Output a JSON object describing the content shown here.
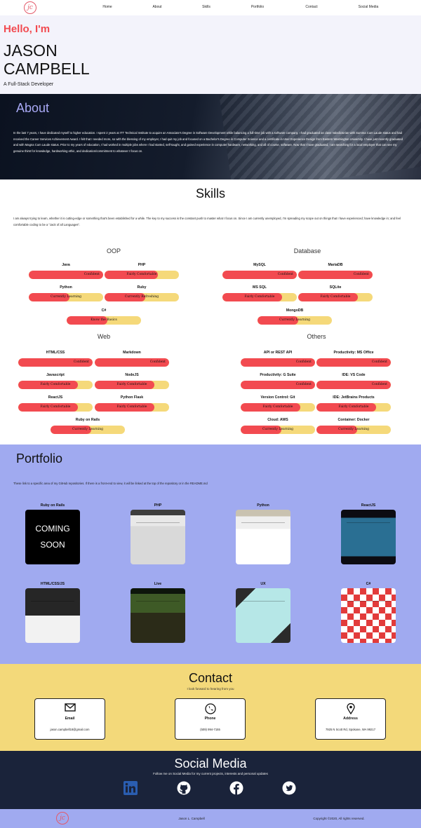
{
  "nav": {
    "logo_text": "jc",
    "items": [
      "Home",
      "About",
      "Skills",
      "Portfolio",
      "Contact",
      "Social Media"
    ]
  },
  "hero": {
    "greeting": "Hello, I'm",
    "name": "JASON CAMPBELL",
    "title": "A Full-Stack Developer"
  },
  "about": {
    "title": "About",
    "text": "In the last 7 years, I have dedicated myself to higher education. I spent 2 years at ITT Technical Institute to acquire an Associate's Degree in Software Development while balancing a full-time job with a software company. I had graduated as class Valedictorian with Summa Cum Laude status and had received the Career Services Achievement Award. I felt that I needed more, so with the blessing of my employer, I had quit my job and focused on a Bachelor's Degree in Computer Science and a certificate in User Experience Design from Eastern Washington University. I have just recently graduated and with Magna Cum Laude status. Prior to my years of education, I had worked in multiple jobs where I had started, self-taught, and gained experience in computer hardware, networking, and all of course, software. Now that I have graduated, I am searching for a local employer that can see my genuine thirst for knowledge, hardworking ethic, and dedication/commitment to whatever I focus on."
  },
  "skills": {
    "title": "Skills",
    "intro": "I am always trying to learn, whether it is cutting-edge or something that's been established for a while. The key to my success is the constant push to master what I focus on. Since I am currently unemployed, I'm spreading my scope out on things that I have experienced; have knowledge in; and feel comfortable coding to be a \"Jack of all Languages\".",
    "categories": [
      {
        "title": "OOP",
        "items": [
          {
            "name": "Java",
            "level": "Confident",
            "fill": 1.0
          },
          {
            "name": "PHP",
            "level": "Fairly Comfortable",
            "fill": 0.72
          },
          {
            "name": "Python",
            "level": "Currently Learning",
            "fill": 0.55
          },
          {
            "name": "Ruby",
            "level": "Currently Refreshing",
            "fill": 0.55
          },
          {
            "name": "C#",
            "level": "Know the Basics",
            "fill": 0.55
          }
        ]
      },
      {
        "title": "Database",
        "items": [
          {
            "name": "MySQL",
            "level": "Confident",
            "fill": 1.0
          },
          {
            "name": "MariaDB",
            "level": "Confident",
            "fill": 1.0
          },
          {
            "name": "MS SQL",
            "level": "Fairly Comfortable",
            "fill": 0.8
          },
          {
            "name": "SQLite",
            "level": "Fairly Comfortable",
            "fill": 0.8
          },
          {
            "name": "MongoDB",
            "level": "Currently Learning",
            "fill": 0.55
          }
        ]
      },
      {
        "title": "Web",
        "items": [
          {
            "name": "HTML/CSS",
            "level": "Confident",
            "fill": 1.0
          },
          {
            "name": "Markdown",
            "level": "Confident",
            "fill": 1.0
          },
          {
            "name": "Javascript",
            "level": "Fairly Comfortable",
            "fill": 0.8
          },
          {
            "name": "NodeJS",
            "level": "Fairly Comfortable",
            "fill": 0.8
          },
          {
            "name": "ReactJS",
            "level": "Fairly Comfortable",
            "fill": 0.8
          },
          {
            "name": "Python Flask",
            "level": "Fairly Comfortable",
            "fill": 0.8
          },
          {
            "name": "Ruby on Rails",
            "level": "Currently Learning",
            "fill": 0.55
          }
        ]
      },
      {
        "title": "Others",
        "items": [
          {
            "name": "API or REST API",
            "level": "Confident",
            "fill": 1.0
          },
          {
            "name": "Productivity: MS Office",
            "level": "Confident",
            "fill": 1.0
          },
          {
            "name": "Productivity: G Suite",
            "level": "Confident",
            "fill": 1.0
          },
          {
            "name": "IDE: VS Code",
            "level": "Confident",
            "fill": 1.0
          },
          {
            "name": "Version Control: Git",
            "level": "Fairly Comfortable",
            "fill": 0.8
          },
          {
            "name": "IDE: JetBrains Products",
            "level": "Fairly Comfortable",
            "fill": 0.8
          },
          {
            "name": "Cloud: AWS",
            "level": "Currently Learning",
            "fill": 0.55
          },
          {
            "name": "Container: Docker",
            "level": "Currently Learning",
            "fill": 0.55
          }
        ]
      }
    ]
  },
  "portfolio": {
    "title": "Portfolio",
    "intro": "These link to a specific area of my GitHub repositories. If there is a front-end to view, it will be linked at the top of the repository or in the README.md",
    "projects": [
      {
        "label": "Ruby on Rails",
        "thumb": "COMING SOON"
      },
      {
        "label": "PHP",
        "thumb": ""
      },
      {
        "label": "Python",
        "thumb": ""
      },
      {
        "label": "ReactJS",
        "thumb": ""
      },
      {
        "label": "HTML/CSS/JS",
        "thumb": ""
      },
      {
        "label": "Live",
        "thumb": ""
      },
      {
        "label": "UX",
        "thumb": ""
      },
      {
        "label": "C#",
        "thumb": ""
      }
    ]
  },
  "contact": {
    "title": "Contact",
    "subtitle": "I look forward to hearing from you",
    "cards": [
      {
        "label": "Email",
        "value": "jason.campbell18@gmail.com",
        "icon": "envelope-icon"
      },
      {
        "label": "Phone",
        "value": "(509) 994-7155",
        "icon": "phone-icon"
      },
      {
        "label": "Address",
        "value": "7925 N Scott Rd, Spokane, WA 99217",
        "icon": "map-pin-icon"
      }
    ]
  },
  "social": {
    "title": "Social Media",
    "subtitle": "Follow me on Social Media for my current projects, interests and personal updates",
    "icons": [
      "linkedin-icon",
      "github-icon",
      "facebook-icon",
      "twitter-icon"
    ]
  },
  "footer": {
    "name": "Jason L. Campbell",
    "copyright": "Copyright ©2020, All rights reserved."
  },
  "colors": {
    "accent_red": "#f24a50",
    "bar_track": "#f5d97a",
    "lavender": "#a0aaf0",
    "contact_yellow": "#f3d97a",
    "navy": "#1a233a"
  }
}
